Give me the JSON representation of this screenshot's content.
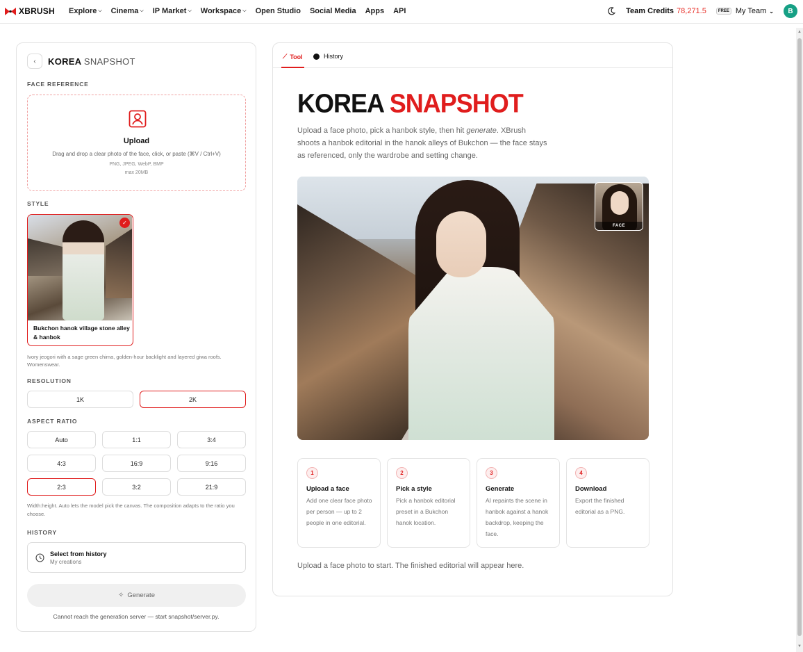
{
  "brand": {
    "name": "XBRUSH"
  },
  "nav": [
    {
      "label": "Explore",
      "dropdown": true
    },
    {
      "label": "Cinema",
      "dropdown": true
    },
    {
      "label": "IP Market",
      "dropdown": true
    },
    {
      "label": "Workspace",
      "dropdown": true
    },
    {
      "label": "Open Studio",
      "dropdown": false
    },
    {
      "label": "Social Media",
      "dropdown": false
    },
    {
      "label": "Apps",
      "dropdown": false
    },
    {
      "label": "API",
      "dropdown": false
    }
  ],
  "account": {
    "credits_label": "Team Credits",
    "credits_value": "78,271.5",
    "plan_badge": "FREE",
    "team_name": "My Team",
    "avatar_initial": "B"
  },
  "left": {
    "title_bold": "KOREA",
    "title_light": "SNAPSHOT",
    "face_ref_label": "FACE REFERENCE",
    "upload": {
      "title": "Upload",
      "desc": "Drag and drop a clear photo of the face, click, or paste (⌘V / Ctrl+V)",
      "formats": "PNG, JPEG, WebP, BMP",
      "max": "max 20MB"
    },
    "style_label": "STYLE",
    "style_card": {
      "name": "Bukchon hanok village stone alley & hanbok",
      "selected": true
    },
    "style_desc": "Ivory jeogori with a sage green chima, golden-hour backlight and layered giwa roofs. Womenswear.",
    "resolution_label": "RESOLUTION",
    "resolution_options": [
      "1K",
      "2K"
    ],
    "resolution_selected": "2K",
    "aspect_label": "ASPECT RATIO",
    "aspect_options": [
      "Auto",
      "1:1",
      "3:4",
      "4:3",
      "16:9",
      "9:16",
      "2:3",
      "3:2",
      "21:9"
    ],
    "aspect_selected": "2:3",
    "aspect_hint": "Width:height. Auto lets the model pick the canvas. The composition adapts to the ratio you choose.",
    "history_label": "HISTORY",
    "history_btn_title": "Select from history",
    "history_btn_sub": "My creations",
    "generate_label": "Generate",
    "server_msg": "Cannot reach the generation server — start snapshot/server.py."
  },
  "right": {
    "tabs": [
      {
        "label": "Tool",
        "icon": "wand-icon",
        "active": true
      },
      {
        "label": "History",
        "icon": "dot-icon",
        "active": false
      }
    ],
    "hero_title_a": "KOREA",
    "hero_title_b": "SNAPSHOT",
    "intro_a": "Upload a face photo, pick a hanbok style, then hit ",
    "intro_em": "generate",
    "intro_b": ". XBrush shoots a hanbok editorial in the hanok alleys of Bukchon — the face stays as referenced, only the wardrobe and setting change.",
    "face_badge": "FACE",
    "steps": [
      {
        "num": "1",
        "title": "Upload a face",
        "desc": "Add one clear face photo per person — up to 2 people in one editorial."
      },
      {
        "num": "2",
        "title": "Pick a style",
        "desc": "Pick a hanbok editorial preset in a Bukchon hanok location."
      },
      {
        "num": "3",
        "title": "Generate",
        "desc": "AI repaints the scene in hanbok against a hanok backdrop, keeping the face."
      },
      {
        "num": "4",
        "title": "Download",
        "desc": "Export the finished editorial as a PNG."
      }
    ],
    "start_msg": "Upload a face photo to start. The finished editorial will appear here."
  },
  "colors": {
    "accent": "#e01d1d",
    "credits": "#e8322b",
    "avatar": "#16a085"
  }
}
